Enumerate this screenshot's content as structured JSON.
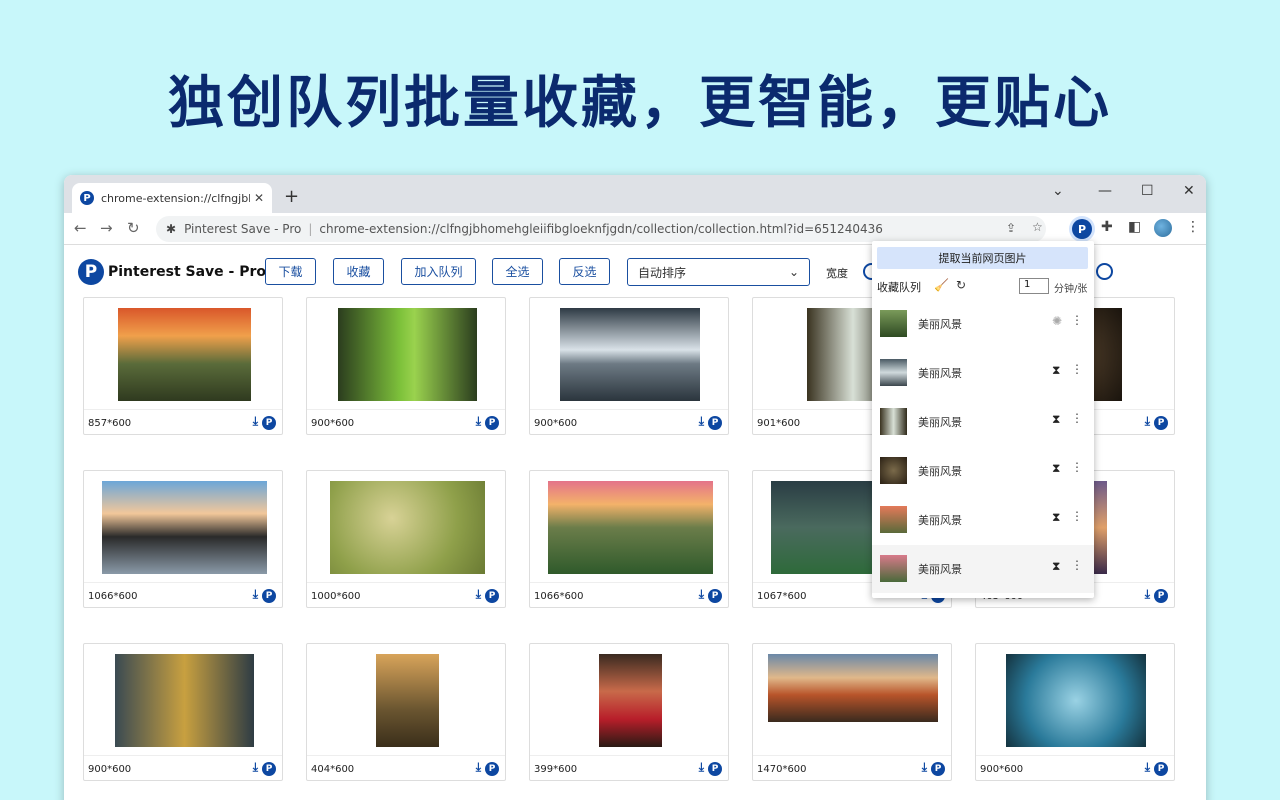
{
  "headline": "独创队列批量收藏，更智能，更贴心",
  "browser": {
    "tab_title": "chrome-extension://clfngjbho",
    "tab_close": "✕",
    "new_tab": "+",
    "url_site": "Pinterest Save - Pro",
    "url_path": "chrome-extension://clfngjbhomehgleiifibgloeknfjgdn/collection/collection.html?id=651240436"
  },
  "app": {
    "name": "Pinterest Save - Pro",
    "buttons": {
      "download": "下载",
      "collect": "收藏",
      "enqueue": "加入队列",
      "select_all": "全选",
      "invert": "反选"
    },
    "sort_value": "自动排序",
    "width_label": "宽度"
  },
  "cards": [
    {
      "dim": "857*600"
    },
    {
      "dim": "900*600"
    },
    {
      "dim": "900*600"
    },
    {
      "dim": "901*600"
    },
    {
      "dim": ""
    },
    {
      "dim": "1066*600"
    },
    {
      "dim": "1000*600"
    },
    {
      "dim": "1066*600"
    },
    {
      "dim": "1067*600"
    },
    {
      "dim": "405*600"
    },
    {
      "dim": "900*600"
    },
    {
      "dim": "404*600"
    },
    {
      "dim": "399*600"
    },
    {
      "dim": "1470*600"
    },
    {
      "dim": "900*600"
    }
  ],
  "popup": {
    "extract_button": "提取当前网页图片",
    "queue_title": "收藏队列",
    "rate_value": "1",
    "rate_unit": "分钟/张",
    "items": [
      {
        "label": "美丽风景",
        "status": "loading"
      },
      {
        "label": "美丽风景",
        "status": "waiting"
      },
      {
        "label": "美丽风景",
        "status": "waiting"
      },
      {
        "label": "美丽风景",
        "status": "waiting"
      },
      {
        "label": "美丽风景",
        "status": "waiting"
      },
      {
        "label": "美丽风景",
        "status": "waiting"
      }
    ]
  },
  "colors": {
    "accent": "#0d47a1",
    "background": "#c8f7fa",
    "headline": "#0b2a6e"
  }
}
